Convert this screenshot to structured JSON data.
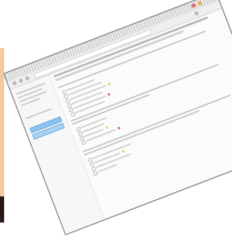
{
  "colors": {
    "accent": "#8cc2ee",
    "left_panel": "#f7c89a",
    "left_panel_dark": "#2a1a17",
    "mark_yellow": "#e6c54a",
    "mark_red": "#d85b5b"
  }
}
